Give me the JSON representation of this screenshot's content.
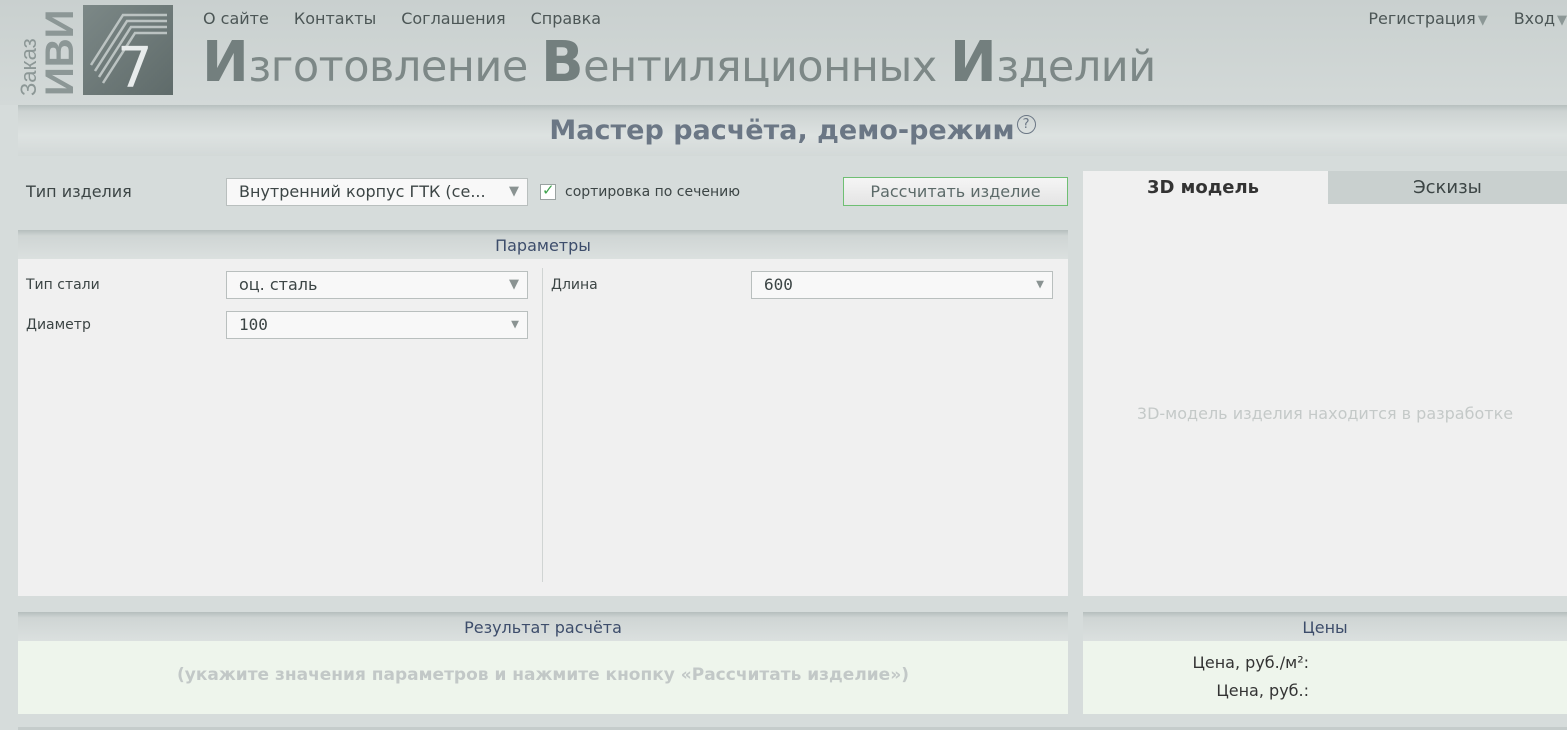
{
  "logo": {
    "vertical_small": "Заказ",
    "vertical_big": "ИВИ",
    "mark_glyph": "7"
  },
  "nav": {
    "items": [
      "О сайте",
      "Контакты",
      "Соглашения",
      "Справка"
    ],
    "register_label": "Регистрация",
    "login_label": "Вход",
    "caret_glyph": "▼"
  },
  "brand": {
    "word1_cap": "И",
    "word1_rest": "зготовление ",
    "word2_cap": "В",
    "word2_rest": "ентиляционных ",
    "word3_cap": "И",
    "word3_rest": "зделий"
  },
  "page_title": "Мастер расчёта, демо-режим",
  "help_glyph": "?",
  "product": {
    "label": "Тип изделия",
    "selected": "Внутренний корпус ГТК (се...",
    "sort_checked": true,
    "sort_label": "сортировка по сечению",
    "calc_button": "Рассчитать изделие"
  },
  "params": {
    "header": "Параметры",
    "steel_label": "Тип стали",
    "steel_value": "оц. сталь",
    "diameter_label": "Диаметр",
    "diameter_value": "100",
    "length_label": "Длина",
    "length_value": "600"
  },
  "tabs": {
    "model": "3D модель",
    "sketches": "Эскизы",
    "model_message": "3D-модель изделия находится в разработке"
  },
  "result": {
    "header": "Результат расчёта",
    "hint": "(укажите значения параметров и нажмите кнопку «Рассчитать изделие»)"
  },
  "prices": {
    "header": "Цены",
    "per_m2_label": "Цена, руб./м²:",
    "total_label": "Цена, руб.:"
  },
  "colors": {
    "accent_green": "#3fa34d",
    "header_text": "#3d4d6b",
    "title_text": "#6b7785"
  }
}
